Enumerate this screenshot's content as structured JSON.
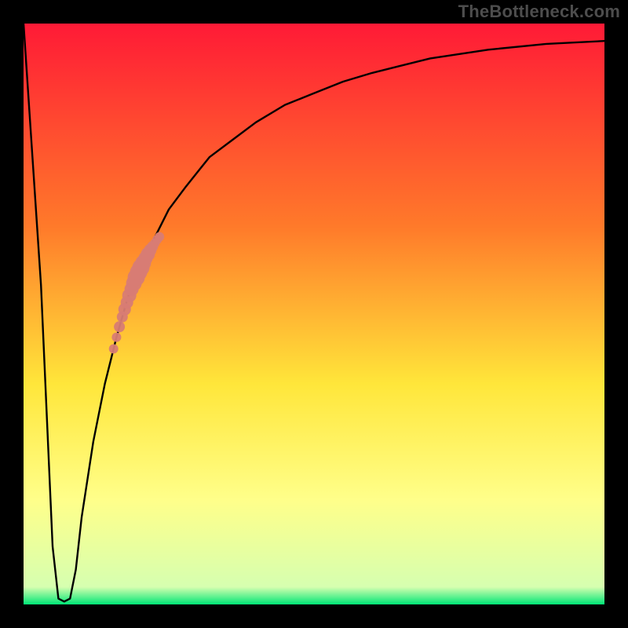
{
  "watermark": "TheBottleneck.com",
  "colors": {
    "black": "#000000",
    "curve": "#000000",
    "marker": "#d87c74",
    "gradient_top": "#ff1a36",
    "gradient_mid1": "#ff7a2a",
    "gradient_mid2": "#ffe63a",
    "gradient_mid3": "#ffff8a",
    "gradient_bottom": "#00e676"
  },
  "chart_data": {
    "type": "line",
    "title": "",
    "xlabel": "",
    "ylabel": "",
    "xlim": [
      0,
      100
    ],
    "ylim": [
      0,
      100
    ],
    "grid": false,
    "legend": false,
    "series": [
      {
        "name": "bottleneck-curve",
        "x": [
          0,
          3,
          5,
          6,
          7,
          8,
          9,
          10,
          12,
          14,
          16,
          18,
          20,
          22,
          25,
          28,
          32,
          36,
          40,
          45,
          50,
          55,
          60,
          70,
          80,
          90,
          100
        ],
        "y": [
          100,
          55,
          10,
          1,
          0.5,
          1,
          6,
          15,
          28,
          38,
          46,
          53,
          58,
          62,
          68,
          72,
          77,
          80,
          83,
          86,
          88,
          90,
          91.5,
          94,
          95.5,
          96.5,
          97
        ]
      }
    ],
    "markers": {
      "name": "highlighted-range",
      "color": "#d87c74",
      "x": [
        15.5,
        16.0,
        16.5,
        17.0,
        17.4,
        17.8,
        18.2,
        18.6,
        19.0,
        19.4,
        19.8,
        20.2,
        20.6,
        21.0,
        21.4,
        21.8,
        22.2,
        22.6,
        23.0,
        23.4
      ],
      "y": [
        44.0,
        46.0,
        47.8,
        49.5,
        50.8,
        52.0,
        53.2,
        54.3,
        55.3,
        56.3,
        57.2,
        58.0,
        58.8,
        59.6,
        60.3,
        61.0,
        61.6,
        62.2,
        62.8,
        63.3
      ]
    },
    "marker_sizes": [
      6,
      6,
      7,
      7,
      8,
      8,
      9,
      9,
      10,
      11,
      11,
      11,
      10,
      9,
      9,
      8,
      7,
      6,
      6,
      6
    ]
  }
}
